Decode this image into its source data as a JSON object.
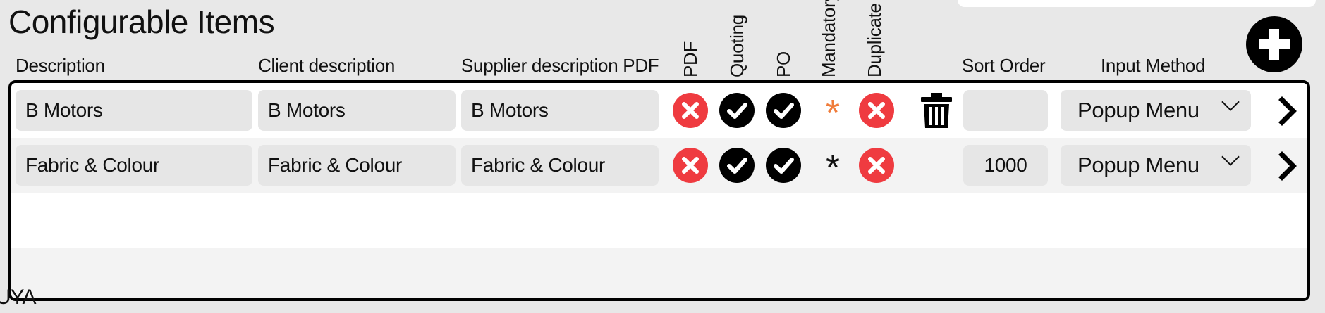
{
  "title": "Configurable Items",
  "columns": {
    "description": "Description",
    "client_description": "Client description",
    "supplier_description_pdf": "Supplier description PDF",
    "pdf": "PDF",
    "quoting": "Quoting",
    "po": "PO",
    "mandatory": "Mandatory",
    "duplicate": "Duplicate",
    "sort_order": "Sort Order",
    "input_method": "Input Method"
  },
  "rows": [
    {
      "description": "B Motors",
      "client_description": "B Motors",
      "supplier_description_pdf": "B Motors",
      "pdf": false,
      "quoting": true,
      "po": true,
      "mandatory": "*",
      "mandatory_color": "#f07c3a",
      "duplicate": false,
      "delete_icon": "trash-icon",
      "sort_order": "",
      "input_method": "Popup Menu"
    },
    {
      "description": "Fabric & Colour",
      "client_description": "Fabric & Colour",
      "supplier_description_pdf": "Fabric & Colour",
      "pdf": false,
      "quoting": true,
      "po": true,
      "mandatory": "*",
      "mandatory_color": "#111111",
      "duplicate": false,
      "sort_order": "1000",
      "input_method": "Popup Menu"
    }
  ],
  "footer_text": "UYA",
  "colors": {
    "cross": "#ef3b40",
    "check": "#000000",
    "background": "#e8e8e8"
  },
  "icons": {
    "add": "plus-circle-icon",
    "false_state": "x-circle-icon",
    "true_state": "check-circle-icon",
    "row_action": "chevron-right-icon",
    "dropdown": "chevron-down-icon"
  }
}
